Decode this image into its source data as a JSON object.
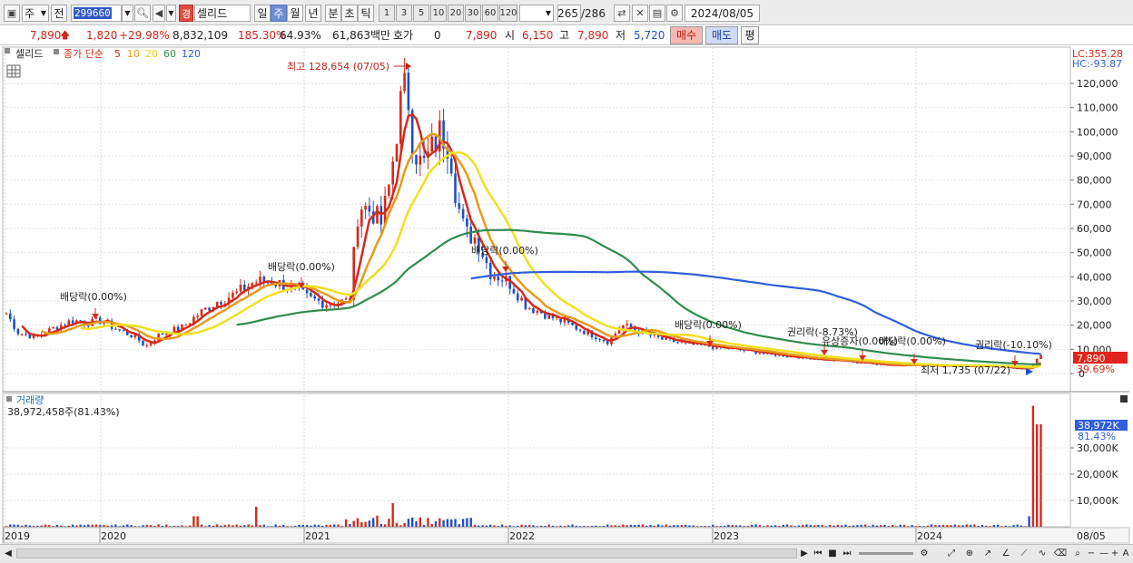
{
  "toolbar": {
    "market": "주",
    "prev": "전",
    "code": "299660",
    "badge": "경",
    "name": "셀리드",
    "periods": [
      "일",
      "주",
      "월",
      "년",
      "분",
      "초",
      "틱"
    ],
    "period_selected": "주",
    "nums": [
      "1",
      "3",
      "5",
      "10",
      "20",
      "30",
      "60",
      "120"
    ],
    "count": "265",
    "total": "/286",
    "date": "2024/08/05"
  },
  "quote": {
    "price": "7,890",
    "arrow": "🡅",
    "change": "1,820",
    "change_pct": "+29.98%",
    "volume": "8,832,109",
    "vol_ratio": "185.30%",
    "turnover": "64.93%",
    "amount": "61,863백만",
    "hoga_label": "호가",
    "hoga_val": "0",
    "hoga_price": "7,890",
    "open_label": "시",
    "open": "6,150",
    "high_label": "고",
    "high": "7,890",
    "low_label": "저",
    "low": "5,720",
    "buy": "매수",
    "sell": "매도",
    "eval": "평"
  },
  "legend": {
    "title": "셀리드",
    "ma_label": "종가 단순",
    "ma_periods": [
      "5",
      "10",
      "20",
      "60",
      "120"
    ],
    "ma_colors": [
      "#d42a1c",
      "#e89a1a",
      "#f0e020",
      "#2f8c4e",
      "#2f5ed8"
    ],
    "lc": "LC:355.28",
    "hc": "HC:-93.87"
  },
  "annotations": {
    "high": "최고 128,654 (07/05)",
    "low": "최저 1,735 (07/22)",
    "events": [
      "배당락(0.00%)",
      "배당락(0.00%)",
      "배당락(0.00%)",
      "배당락(0.00%)",
      "권리락(-8.73%)",
      "유상증자(0.00%)",
      "배당락(0.00%)",
      "권리락(-10.10%)"
    ]
  },
  "price_axis": [
    "120,000",
    "110,000",
    "100,000",
    "90,000",
    "80,000",
    "70,000",
    "60,000",
    "50,000",
    "40,000",
    "30,000",
    "20,000",
    "10,000",
    "0"
  ],
  "current_price": "7,890",
  "current_pct": "39.69%",
  "volume_panel": {
    "title": "거래량",
    "summary": "38,972,458주(81.43%)",
    "axis": [
      "30,000K",
      "20,000K",
      "10,000K"
    ],
    "current": "38,972K",
    "current_pct": "81.43%"
  },
  "time_axis": [
    "2019",
    "2020",
    "2021",
    "2022",
    "2023",
    "2024",
    "08/05"
  ],
  "colors": {
    "up": "#d42a1c",
    "down": "#1f4fc4",
    "accent": "#3159c5"
  }
}
